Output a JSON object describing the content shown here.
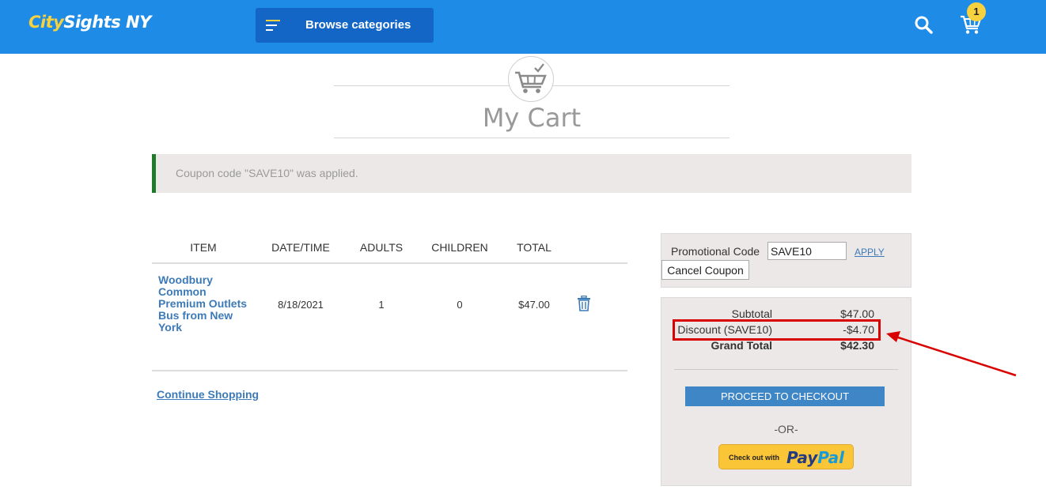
{
  "header": {
    "logo_city": "City",
    "logo_sights": "Sights NY",
    "browse_label": "Browse categories",
    "cart_count": "1",
    "accent_color": "#1e8be6",
    "icons": [
      "menu-icon",
      "search-icon",
      "cart-icon"
    ]
  },
  "page": {
    "title": "My Cart"
  },
  "alert": {
    "message": "Coupon code \"SAVE10\" was applied."
  },
  "cart_table": {
    "columns": [
      "ITEM",
      "DATE/TIME",
      "ADULTS",
      "CHILDREN",
      "TOTAL"
    ],
    "rows": [
      {
        "item": "Woodbury Common Premium Outlets Bus from New York",
        "date": "8/18/2021",
        "adults": "1",
        "children": "0",
        "total": "$47.00"
      }
    ],
    "continue_label": "Continue Shopping"
  },
  "promo": {
    "label": "Promotional Code",
    "value": "SAVE10",
    "apply_label": "APPLY",
    "cancel_label": "Cancel Coupon"
  },
  "totals": {
    "subtotal_label": "Subtotal",
    "subtotal_value": "$47.00",
    "discount_label": "Discount (SAVE10)",
    "discount_value": "-$4.70",
    "grand_label": "Grand Total",
    "grand_value": "$42.30",
    "checkout_label": "PROCEED TO CHECKOUT",
    "or_label": "-OR-",
    "paypal_small": "Check out with",
    "paypal_pay": "Pay",
    "paypal_pal": "Pal"
  }
}
